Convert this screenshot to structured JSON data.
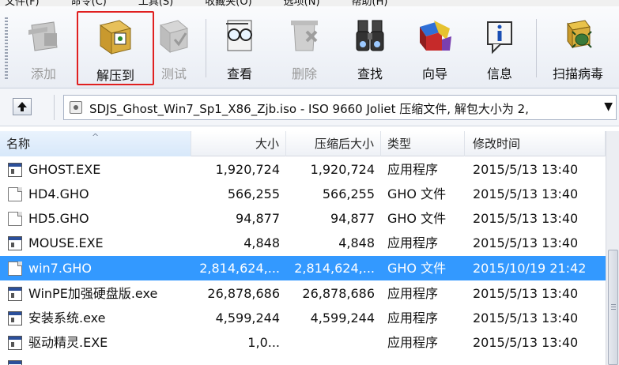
{
  "menu": {
    "items": [
      "文件(F)",
      "命令(C)",
      "工具(S)",
      "收藏夹(O)",
      "选项(N)",
      "帮助(H)"
    ]
  },
  "toolbar": {
    "buttons": [
      {
        "label": "添加",
        "icon": "add-archive-icon",
        "enabled": false
      },
      {
        "label": "解压到",
        "icon": "extract-to-icon",
        "enabled": true,
        "highlighted": true
      },
      {
        "label": "测试",
        "icon": "test-icon",
        "enabled": false
      },
      {
        "label": "查看",
        "icon": "view-icon",
        "enabled": true
      },
      {
        "label": "删除",
        "icon": "delete-icon",
        "enabled": false
      },
      {
        "label": "查找",
        "icon": "find-icon",
        "enabled": true
      },
      {
        "label": "向导",
        "icon": "wizard-icon",
        "enabled": true
      },
      {
        "label": "信息",
        "icon": "info-icon",
        "enabled": true
      },
      {
        "label": "扫描病毒",
        "icon": "scan-virus-icon",
        "enabled": true
      }
    ],
    "highlight_color": "#e02020"
  },
  "address": {
    "text": "SDJS_Ghost_Win7_Sp1_X86_Zjb.iso - ISO 9660 Joliet 压缩文件, 解包大小为 2,",
    "dropdown": "▼"
  },
  "columns": {
    "name": "名称",
    "size": "大小",
    "packed": "压缩后大小",
    "type": "类型",
    "modified": "修改时间"
  },
  "files": [
    {
      "name": "GHOST.EXE",
      "size": "1,920,724",
      "packed": "1,920,724",
      "type": "应用程序",
      "modified": "2015/5/13 13:40",
      "icon": "exe-icon"
    },
    {
      "name": "HD4.GHO",
      "size": "566,255",
      "packed": "566,255",
      "type": "GHO 文件",
      "modified": "2015/5/13 13:40",
      "icon": "document-icon"
    },
    {
      "name": "HD5.GHO",
      "size": "94,877",
      "packed": "94,877",
      "type": "GHO 文件",
      "modified": "2015/5/13 13:40",
      "icon": "document-icon"
    },
    {
      "name": "MOUSE.EXE",
      "size": "4,848",
      "packed": "4,848",
      "type": "应用程序",
      "modified": "2015/5/13 13:40",
      "icon": "exe-icon"
    },
    {
      "name": "win7.GHO",
      "size": "2,814,624,...",
      "packed": "2,814,624,...",
      "type": "GHO 文件",
      "modified": "2015/10/19 21:42",
      "icon": "document-icon",
      "selected": true
    },
    {
      "name": "WinPE加强硬盘版.exe",
      "size": "26,878,686",
      "packed": "26,878,686",
      "type": "应用程序",
      "modified": "2015/5/13 13:40",
      "icon": "exe-icon"
    },
    {
      "name": "安装系统.exe",
      "size": "4,599,244",
      "packed": "4,599,244",
      "type": "应用程序",
      "modified": "2015/5/13 13:40",
      "icon": "exe-icon"
    },
    {
      "name": "驱动精灵.EXE",
      "size": "1,0...",
      "packed": "",
      "type": "应用程序",
      "modified": "2015/5/13 13:40",
      "icon": "exe-icon"
    }
  ],
  "colors": {
    "selection": "#3399ff",
    "toolbar_bg": "#eef1f6"
  }
}
